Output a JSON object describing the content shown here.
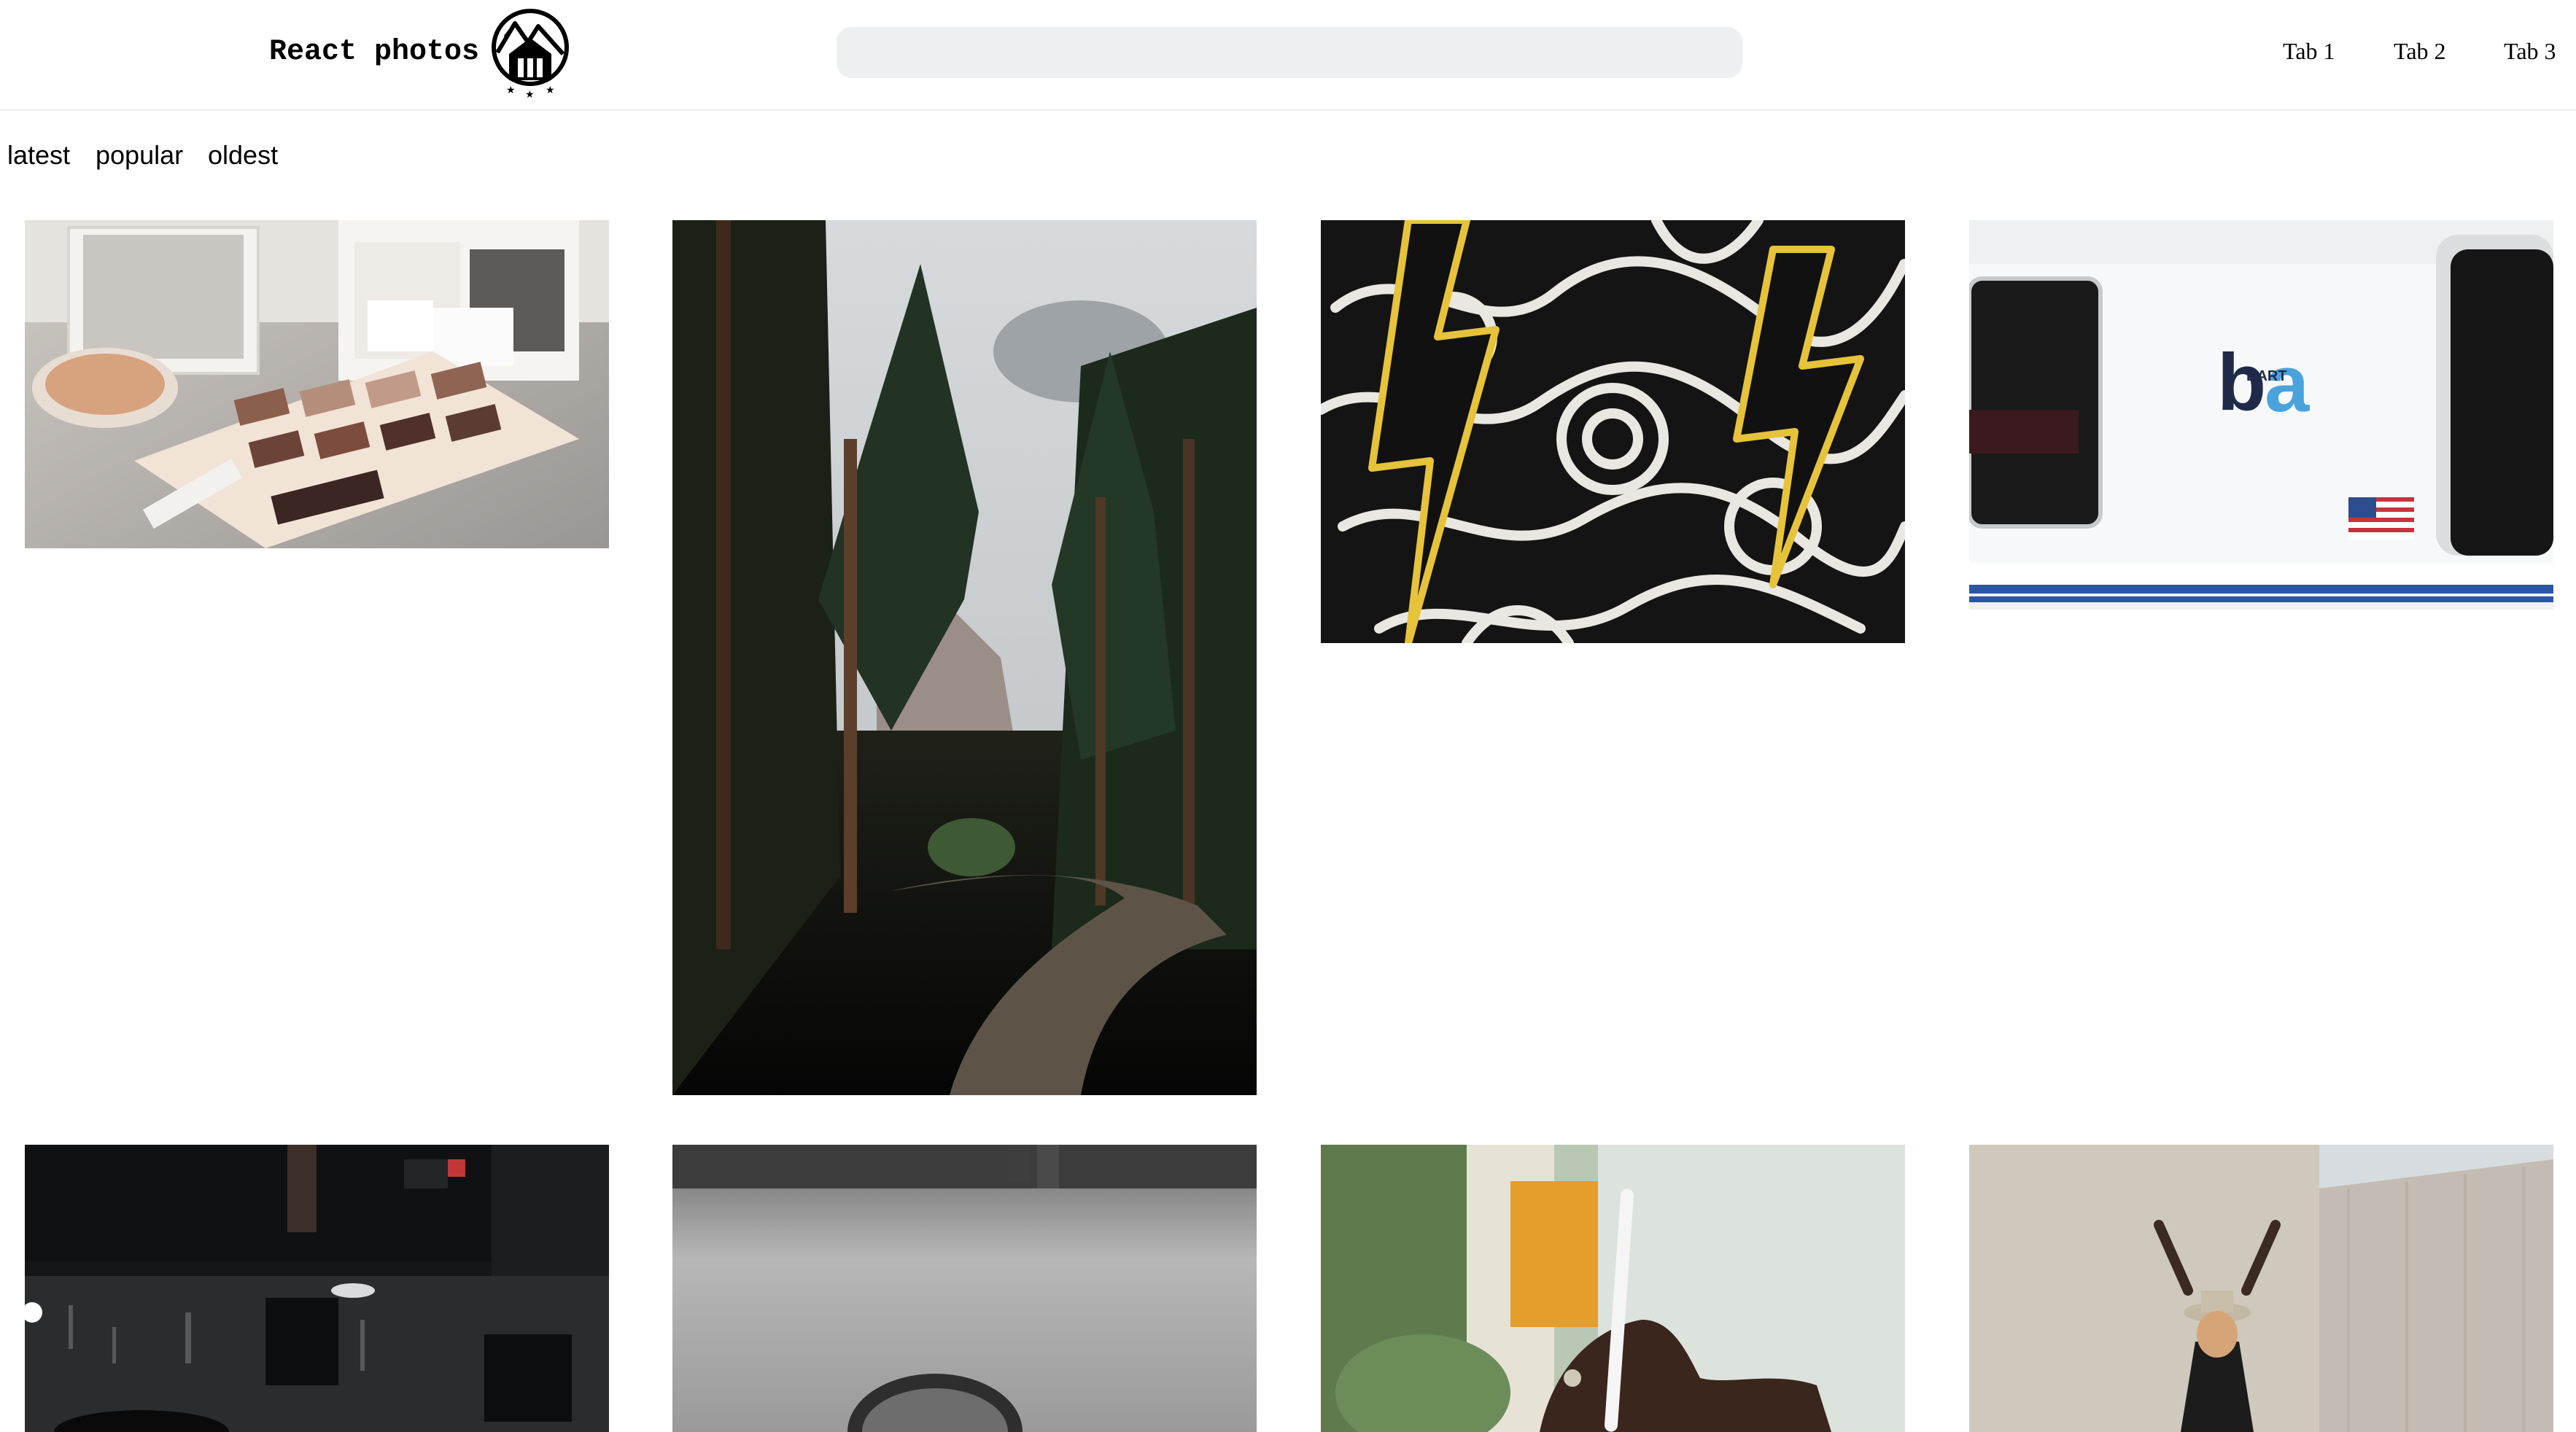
{
  "header": {
    "title": "React photos",
    "logo_icon": "mountain-cabin-logo-icon",
    "search": {
      "value": "",
      "placeholder": ""
    },
    "tabs": [
      {
        "label": "Tab 1"
      },
      {
        "label": "Tab 2"
      },
      {
        "label": "Tab 3"
      }
    ]
  },
  "sort": {
    "options": [
      {
        "label": "latest"
      },
      {
        "label": "popular"
      },
      {
        "label": "oldest"
      }
    ]
  },
  "colors": {
    "search_bg": "#eeeff0",
    "header_border": "#ececec",
    "text": "#000000"
  },
  "photos": [
    {
      "subject": "makeup-palettes"
    },
    {
      "subject": "forest-path"
    },
    {
      "subject": "lightning-mural"
    },
    {
      "subject": "bart-train"
    },
    {
      "subject": "rainy-street-night"
    },
    {
      "subject": "man-black-and-white"
    },
    {
      "subject": "hand-holding-pen"
    },
    {
      "subject": "woman-wall"
    }
  ]
}
